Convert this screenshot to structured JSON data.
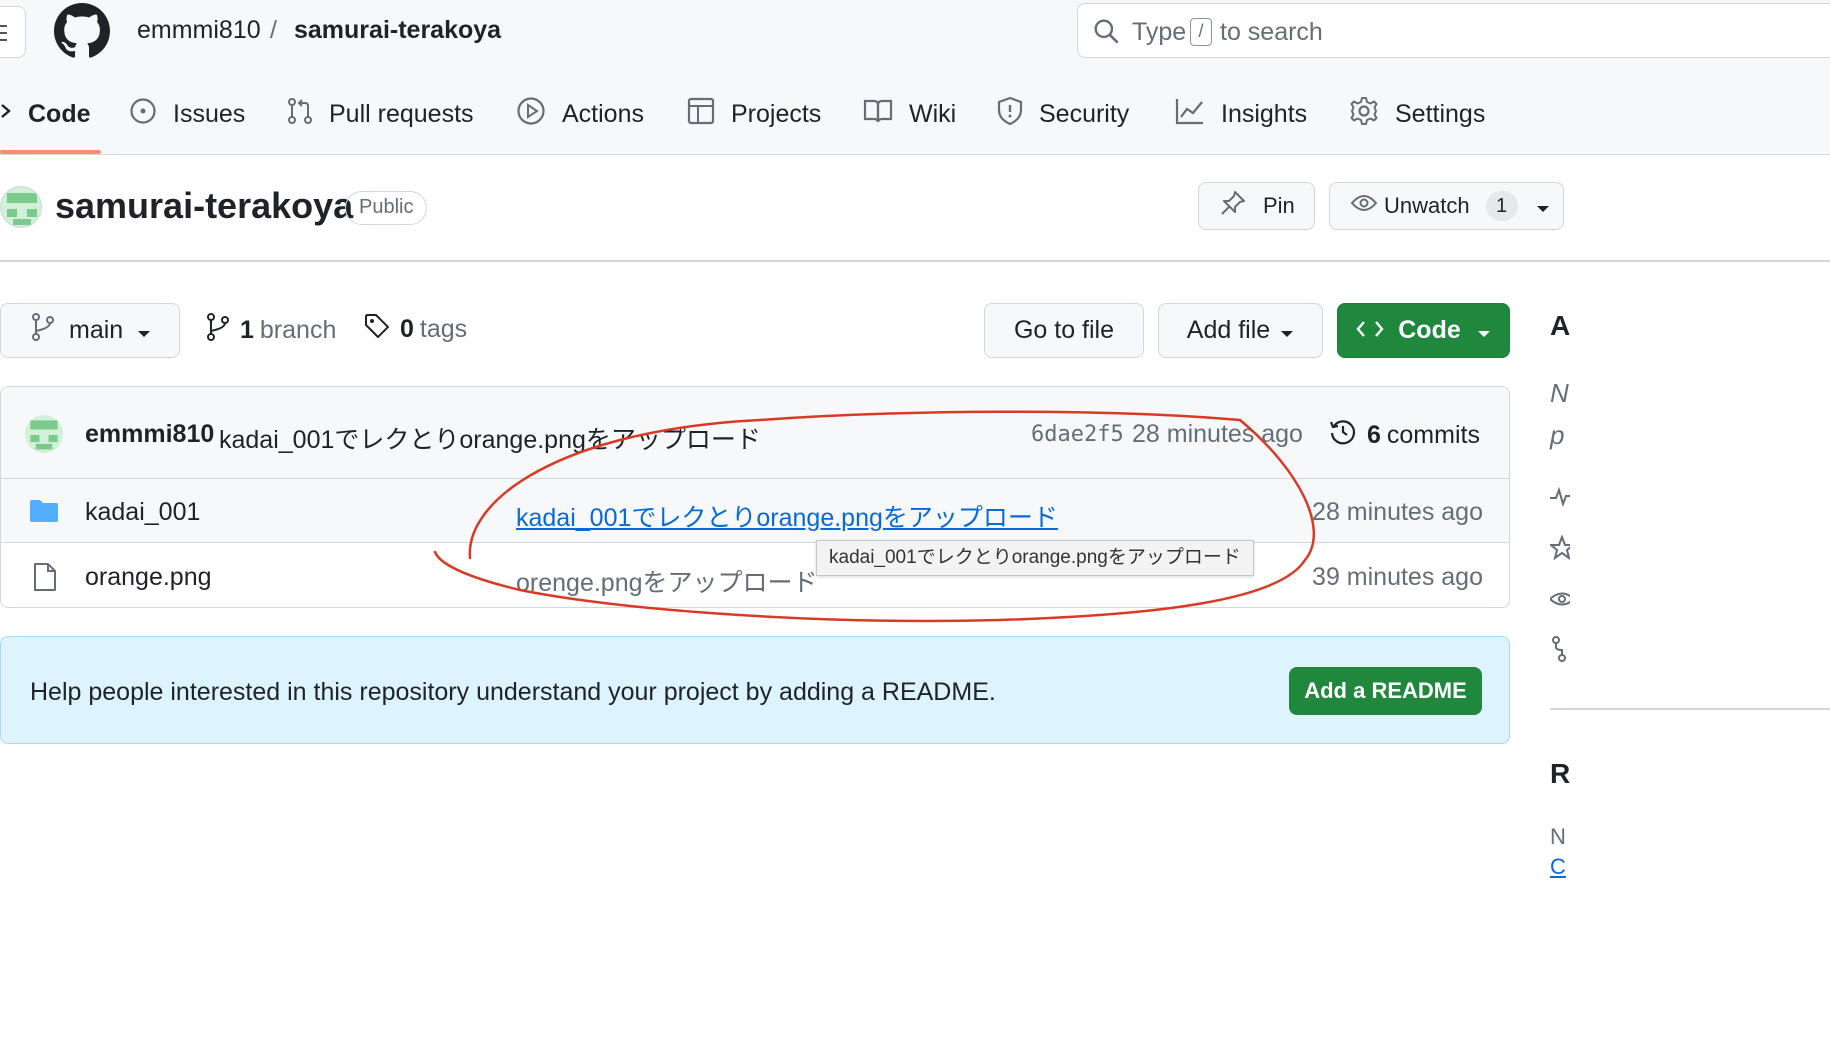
{
  "header": {
    "owner": "emmmi810",
    "separator": "/",
    "repo": "samurai-terakoya",
    "search_prefix": "Type",
    "search_key": "/",
    "search_suffix": "to search"
  },
  "tabs": [
    {
      "label": "Code",
      "icon": "code-icon",
      "active": true
    },
    {
      "label": "Issues",
      "icon": "issue-opened-icon"
    },
    {
      "label": "Pull requests",
      "icon": "git-pull-request-icon"
    },
    {
      "label": "Actions",
      "icon": "play-icon"
    },
    {
      "label": "Projects",
      "icon": "table-icon"
    },
    {
      "label": "Wiki",
      "icon": "book-icon"
    },
    {
      "label": "Security",
      "icon": "shield-icon"
    },
    {
      "label": "Insights",
      "icon": "graph-icon"
    },
    {
      "label": "Settings",
      "icon": "gear-icon"
    }
  ],
  "repo_header": {
    "name": "samurai-terakoya",
    "visibility": "Public",
    "pin_label": "Pin",
    "unwatch_label": "Unwatch",
    "watch_count": "1"
  },
  "toolbar": {
    "branch": "main",
    "branch_count": "1",
    "branch_label": "branch",
    "tag_count": "0",
    "tag_label": "tags",
    "goto_file": "Go to file",
    "add_file": "Add file",
    "code": "Code"
  },
  "latest_commit": {
    "author": "emmmi810",
    "message": "kadai_001でレクとりorange.pngをアップロード",
    "sha": "6dae2f5",
    "time": "28 minutes ago",
    "count": "6",
    "count_label": "commits"
  },
  "files": [
    {
      "type": "folder",
      "name": "kadai_001",
      "message": "kadai_001でレクとりorange.pngをアップロード",
      "time": "28 minutes ago"
    },
    {
      "type": "file",
      "name": "orange.png",
      "message": "orenge.pngをアップロード",
      "time": "39 minutes ago"
    }
  ],
  "tooltip": "kadai_001でレクとりorange.pngをアップロード",
  "readme": {
    "text": "Help people interested in this repository understand your project by adding a README.",
    "button": "Add a README"
  },
  "sidebar": {
    "about": "A",
    "desc_line1": "N",
    "desc_line2": "p",
    "releases": "R",
    "no_releases": "N",
    "create": "C"
  },
  "colors": {
    "accent_green": "#1f883d",
    "link_blue": "#0969da",
    "tab_underline": "#fd8c73",
    "annotation_red": "#d93a26"
  }
}
